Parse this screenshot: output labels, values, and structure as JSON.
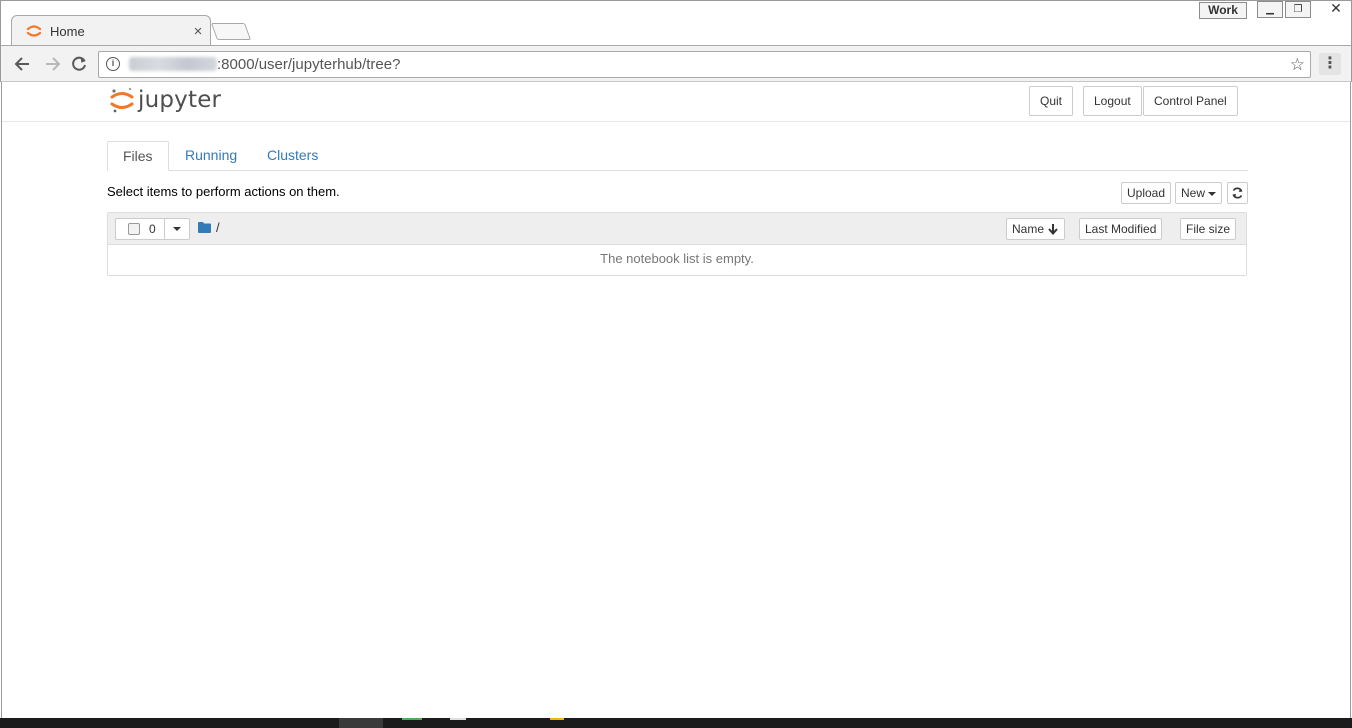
{
  "browser": {
    "tab_title": "Home",
    "tab_close": "×",
    "profile_label": "Work",
    "url_path": ":8000/user/jupyterhub/tree?",
    "colors": {
      "chrome": "#f2f2f2",
      "accent": "#f37726"
    }
  },
  "header": {
    "logo_text": "jupyter",
    "quit_label": "Quit",
    "logout_label": "Logout",
    "control_panel_label": "Control Panel"
  },
  "tabs": [
    {
      "label": "Files"
    },
    {
      "label": "Running"
    },
    {
      "label": "Clusters"
    }
  ],
  "toolbar": {
    "instruction": "Select items to perform actions on them.",
    "upload_label": "Upload",
    "new_label": "New",
    "refresh_icon": "refresh-icon"
  },
  "list": {
    "selected_count": "0",
    "path": "/",
    "columns": [
      {
        "label": "Name"
      },
      {
        "label": "Last Modified"
      },
      {
        "label": "File size"
      }
    ],
    "empty_message": "The notebook list is empty."
  },
  "colors": {
    "link": "#337ab7",
    "border": "#dddddd",
    "header_bg": "#eeeeee"
  }
}
